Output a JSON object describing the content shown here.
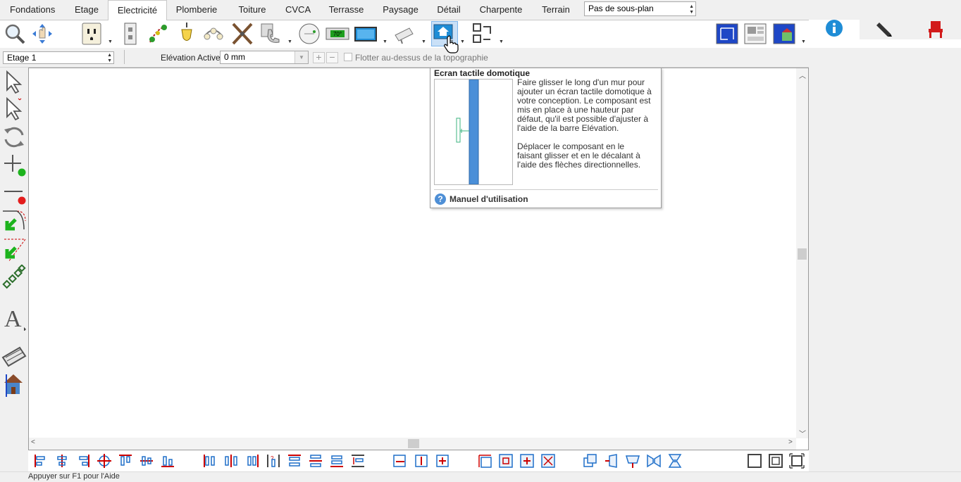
{
  "tabs": [
    {
      "label": "Fondations",
      "active": false
    },
    {
      "label": "Etage",
      "active": false
    },
    {
      "label": "Electricité",
      "active": true
    },
    {
      "label": "Plomberie",
      "active": false
    },
    {
      "label": "Toiture",
      "active": false
    },
    {
      "label": "CVCA",
      "active": false
    },
    {
      "label": "Terrasse",
      "active": false
    },
    {
      "label": "Paysage",
      "active": false
    },
    {
      "label": "Détail",
      "active": false
    },
    {
      "label": "Charpente",
      "active": false
    },
    {
      "label": "Terrain",
      "active": false
    }
  ],
  "subplan_select": {
    "value": "Pas de sous-plan"
  },
  "ribbon": {
    "thermostat_display": "70°",
    "selected_tool": "home-screen-tool"
  },
  "options": {
    "floor_select": "Etage 1",
    "elevation_label": "Elévation Active:",
    "elevation_value": "0 mm",
    "float_label": "Flotter au-dessus de la topographie"
  },
  "tooltip": {
    "title": "Ecran tactile domotique",
    "body": "Faire glisser le long d'un mur pour\najouter un écran tactile domotique à\nvotre conception. Le composant est\nmis en place à une hauteur par\ndéfaut, qu'il est possible d'ajuster à\nl'aide de la barre Elévation.\n\nDéplacer le composant en le\nfaisant glisser et en le décalant à\nl'aide des flèches directionnelles.",
    "help_link": "Manuel d'utilisation"
  },
  "status": {
    "text": "Appuyer sur F1 pour l'Aide"
  },
  "colors": {
    "accent_blue": "#1f8dd6",
    "selection": "#c9e0f7",
    "wall_blue": "#4a8fd8"
  }
}
